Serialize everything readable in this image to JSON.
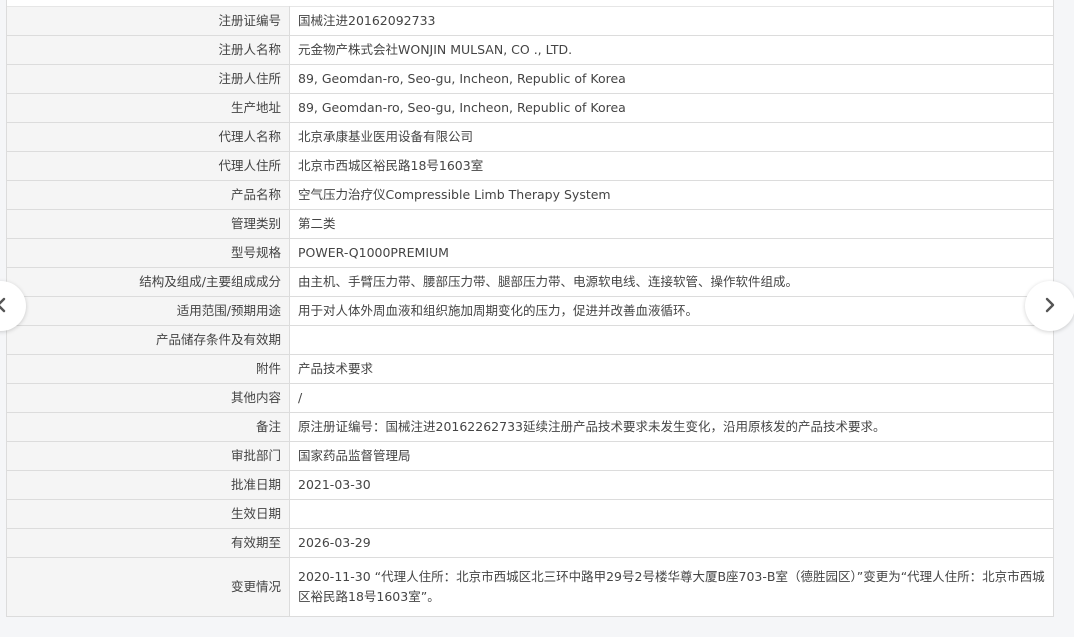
{
  "rows": [
    {
      "label": "注册证编号",
      "value": "国械注进20162092733"
    },
    {
      "label": "注册人名称",
      "value": "元金物产株式会社WONJIN MULSAN, CO ., LTD."
    },
    {
      "label": "注册人住所",
      "value": "89, Geomdan-ro, Seo-gu, Incheon, Republic of Korea"
    },
    {
      "label": "生产地址",
      "value": "89, Geomdan-ro, Seo-gu, Incheon, Republic of Korea"
    },
    {
      "label": "代理人名称",
      "value": "北京承康基业医用设备有限公司"
    },
    {
      "label": "代理人住所",
      "value": "北京市西城区裕民路18号1603室"
    },
    {
      "label": "产品名称",
      "value": "空气压力治疗仪Compressible Limb Therapy System"
    },
    {
      "label": "管理类别",
      "value": "第二类"
    },
    {
      "label": "型号规格",
      "value": "POWER-Q1000PREMIUM"
    },
    {
      "label": "结构及组成/主要组成成分",
      "value": "由主机、手臂压力带、腰部压力带、腿部压力带、电源软电线、连接软管、操作软件组成。"
    },
    {
      "label": "适用范围/预期用途",
      "value": "用于对人体外周血液和组织施加周期变化的压力，促进并改善血液循环。"
    },
    {
      "label": "产品储存条件及有效期",
      "value": ""
    },
    {
      "label": "附件",
      "value": "产品技术要求"
    },
    {
      "label": "其他内容",
      "value": "/"
    },
    {
      "label": "备注",
      "value": "原注册证编号：国械注进20162262733延续注册产品技术要求未发生变化，沿用原核发的产品技术要求。"
    },
    {
      "label": "审批部门",
      "value": "国家药品监督管理局"
    },
    {
      "label": "批准日期",
      "value": "2021-03-30"
    },
    {
      "label": "生效日期",
      "value": ""
    },
    {
      "label": "有效期至",
      "value": "2026-03-29"
    },
    {
      "label": "变更情况",
      "value": "2020-11-30 “代理人住所：北京市西城区北三环中路甲29号2号楼华尊大厦B座703-B室（德胜园区）”变更为“代理人住所：北京市西城区裕民路18号1603室”。"
    }
  ],
  "nav": {
    "prev_icon": "chevron-left-icon",
    "next_icon": "chevron-right-icon"
  }
}
